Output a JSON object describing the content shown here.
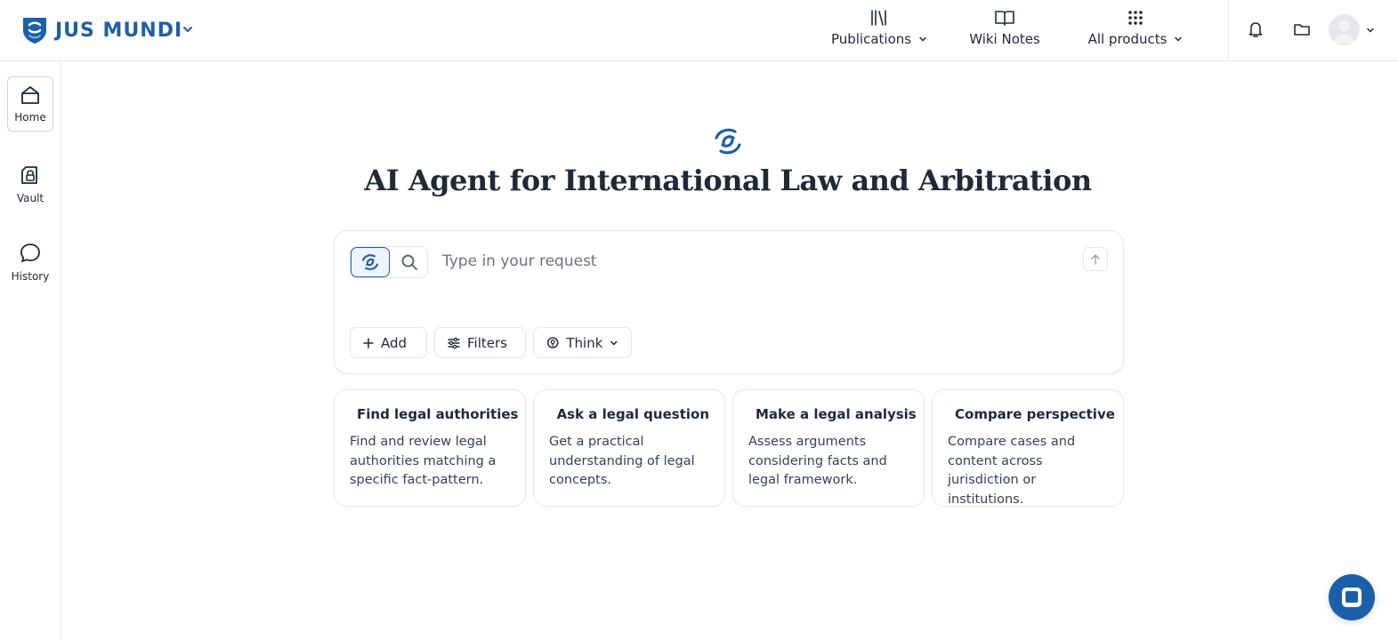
{
  "brand": {
    "name": "JUS MUNDI",
    "primary_color": "#1c5fa8"
  },
  "topnav": {
    "items": [
      {
        "label": "Publications",
        "icon": "books-icon",
        "has_dropdown": true
      },
      {
        "label": "Wiki Notes",
        "icon": "open-book-icon",
        "has_dropdown": false
      },
      {
        "label": "All products",
        "icon": "grid-icon",
        "has_dropdown": true
      }
    ],
    "right_icons": [
      "bell-icon",
      "folder-icon",
      "avatar"
    ]
  },
  "sidebar": {
    "items": [
      {
        "label": "Home",
        "icon": "home-icon",
        "active": true
      },
      {
        "label": "Vault",
        "icon": "vault-lock-icon",
        "active": false
      },
      {
        "label": "History",
        "icon": "chat-bubble-icon",
        "active": false
      }
    ]
  },
  "main": {
    "title": "AI Agent for International Law and Arbitration",
    "request": {
      "placeholder": "Type in your request",
      "value": ""
    },
    "chips": {
      "add": "Add",
      "filters": "Filters",
      "think": "Think"
    },
    "cards": [
      {
        "title": "Find legal authorities",
        "description": "Find and review legal authorities matching a specific fact-pattern."
      },
      {
        "title": "Ask a legal question",
        "description": "Get a practical understanding of legal concepts."
      },
      {
        "title": "Make a legal analysis",
        "description": "Assess arguments considering facts and legal framework."
      },
      {
        "title": "Compare perspective",
        "description": "Compare cases and content across jurisdiction or institutions."
      }
    ]
  }
}
